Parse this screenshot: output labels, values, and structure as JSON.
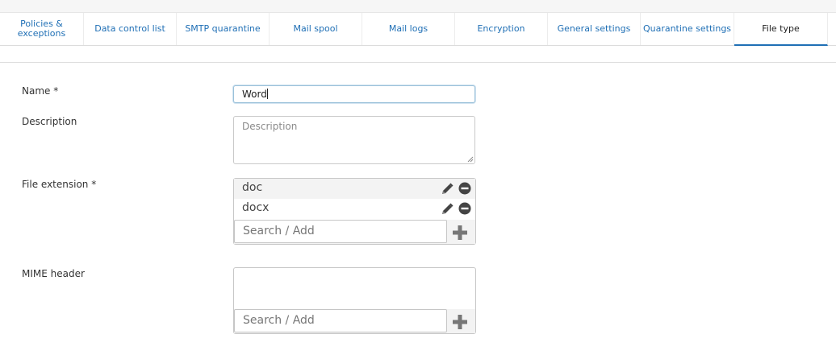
{
  "tabs": [
    {
      "label": "Policies &\nexceptions",
      "active": false
    },
    {
      "label": "Data control list",
      "active": false
    },
    {
      "label": "SMTP quarantine",
      "active": false
    },
    {
      "label": "Mail spool",
      "active": false
    },
    {
      "label": "Mail logs",
      "active": false
    },
    {
      "label": "Encryption",
      "active": false
    },
    {
      "label": "General settings",
      "active": false
    },
    {
      "label": "Quarantine settings",
      "active": false
    },
    {
      "label": "File type",
      "active": true
    }
  ],
  "form": {
    "name_label": "Name *",
    "name_value": "Word",
    "description_label": "Description",
    "description_placeholder": "Description",
    "file_extension_label": "File extension *",
    "file_extensions": [
      "doc",
      "docx"
    ],
    "search_add_placeholder": "Search / Add",
    "mime_label": "MIME header",
    "mime_headers": [],
    "mime_search_placeholder": "Search / Add"
  },
  "icons": {
    "edit": "pencil-icon",
    "remove": "minus-circle-icon",
    "add": "plus-icon"
  },
  "colors": {
    "link": "#1f6fb5",
    "active_underline": "#1f6fb5",
    "icon": "#444444",
    "plus": "#777777"
  }
}
